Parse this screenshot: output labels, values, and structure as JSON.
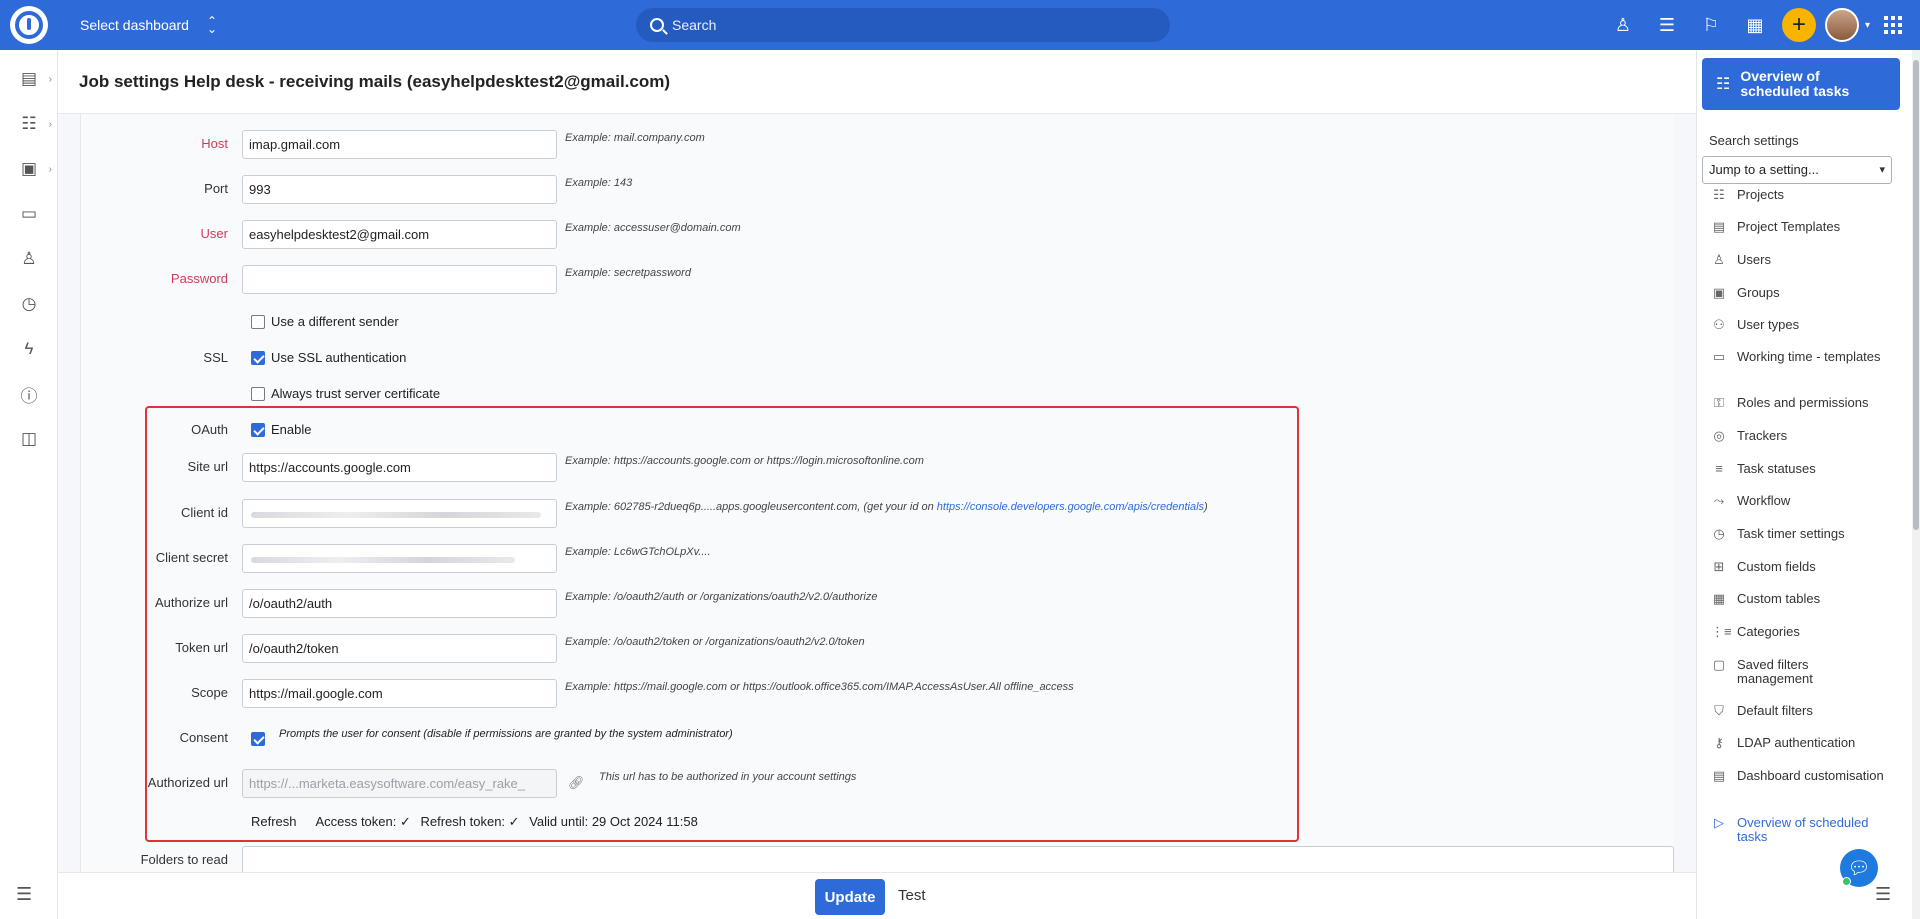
{
  "topbar": {
    "select_dashboard": "Select dashboard",
    "search_placeholder": "Search",
    "plus": "+"
  },
  "page": {
    "title": "Job settings Help desk - receiving mails (easyhelpdesktest2@gmail.com)"
  },
  "form": {
    "host": {
      "label": "Host",
      "value": "imap.gmail.com",
      "hint": "Example: mail.company.com"
    },
    "port": {
      "label": "Port",
      "value": "993",
      "hint": "Example: 143"
    },
    "user": {
      "label": "User",
      "value": "easyhelpdesktest2@gmail.com",
      "hint": "Example: accessuser@domain.com"
    },
    "password": {
      "label": "Password",
      "value": "",
      "hint": "Example: secretpassword"
    },
    "different_sender": {
      "label": "Use a different sender",
      "checked": false
    },
    "ssl": {
      "label": "SSL",
      "option": "Use SSL authentication",
      "checked": true
    },
    "trust_cert": {
      "label": "Always trust server certificate",
      "checked": false
    },
    "oauth": {
      "label": "OAuth",
      "option": "Enable",
      "checked": true
    },
    "site_url": {
      "label": "Site url",
      "value": "https://accounts.google.com",
      "hint": "Example: https://accounts.google.com or https://login.microsoftonline.com"
    },
    "client_id": {
      "label": "Client id",
      "hint_prefix": "Example: 602785-r2dueq6p.....apps.googleusercontent.com, (get your id on ",
      "hint_link": "https://console.developers.google.com/apis/credentials",
      "hint_suffix": ")"
    },
    "client_secret": {
      "label": "Client secret",
      "hint": "Example: Lc6wGTchOLpXv...."
    },
    "authorize_url": {
      "label": "Authorize url",
      "value": "/o/oauth2/auth",
      "hint": "Example: /o/oauth2/auth or /organizations/oauth2/v2.0/authorize"
    },
    "token_url": {
      "label": "Token url",
      "value": "/o/oauth2/token",
      "hint": "Example: /o/oauth2/token or /organizations/oauth2/v2.0/token"
    },
    "scope": {
      "label": "Scope",
      "value": "https://mail.google.com",
      "hint": "Example: https://mail.google.com or https://outlook.office365.com/IMAP.AccessAsUser.All offline_access"
    },
    "consent": {
      "label": "Consent",
      "option": "Prompts the user for consent (disable if permissions are granted by the system administrator)",
      "checked": true
    },
    "authorized_url": {
      "label": "Authorized url",
      "value": "https://...marketa.easysoftware.com/easy_rake_",
      "hint": "This url has to be authorized in your account settings"
    },
    "tokens": {
      "refresh": "Refresh",
      "access": "Access token: ✓",
      "refresh_token": "Refresh token: ✓",
      "valid": "Valid until: 29 Oct 2024 11:58"
    },
    "folders": {
      "label": "Folders to read"
    }
  },
  "actions": {
    "update": "Update",
    "test": "Test"
  },
  "sidebar": {
    "overview": "Overview of scheduled tasks",
    "search_settings": "Search settings",
    "jump": "Jump to a setting...",
    "items": [
      {
        "label": "Projects",
        "icon": "☷"
      },
      {
        "label": "Project Templates",
        "icon": "▤"
      },
      {
        "label": "Users",
        "icon": "♙"
      },
      {
        "label": "Groups",
        "icon": "▣"
      },
      {
        "label": "User types",
        "icon": "⚇"
      },
      {
        "label": "Working time - templates",
        "icon": "▭"
      },
      {
        "label": "Roles and permissions",
        "icon": "⚿"
      },
      {
        "label": "Trackers",
        "icon": "◎"
      },
      {
        "label": "Task statuses",
        "icon": "≡"
      },
      {
        "label": "Workflow",
        "icon": "⤳"
      },
      {
        "label": "Task timer settings",
        "icon": "◷"
      },
      {
        "label": "Custom fields",
        "icon": "⊞"
      },
      {
        "label": "Custom tables",
        "icon": "▦"
      },
      {
        "label": "Categories",
        "icon": "⋮≡"
      },
      {
        "label": "Saved filters management",
        "icon": "▢"
      },
      {
        "label": "Default filters",
        "icon": "⛉"
      },
      {
        "label": "LDAP authentication",
        "icon": "⚷"
      },
      {
        "label": "Dashboard customisation",
        "icon": "▤"
      },
      {
        "label": "Overview of scheduled tasks",
        "icon": "▷"
      }
    ]
  }
}
